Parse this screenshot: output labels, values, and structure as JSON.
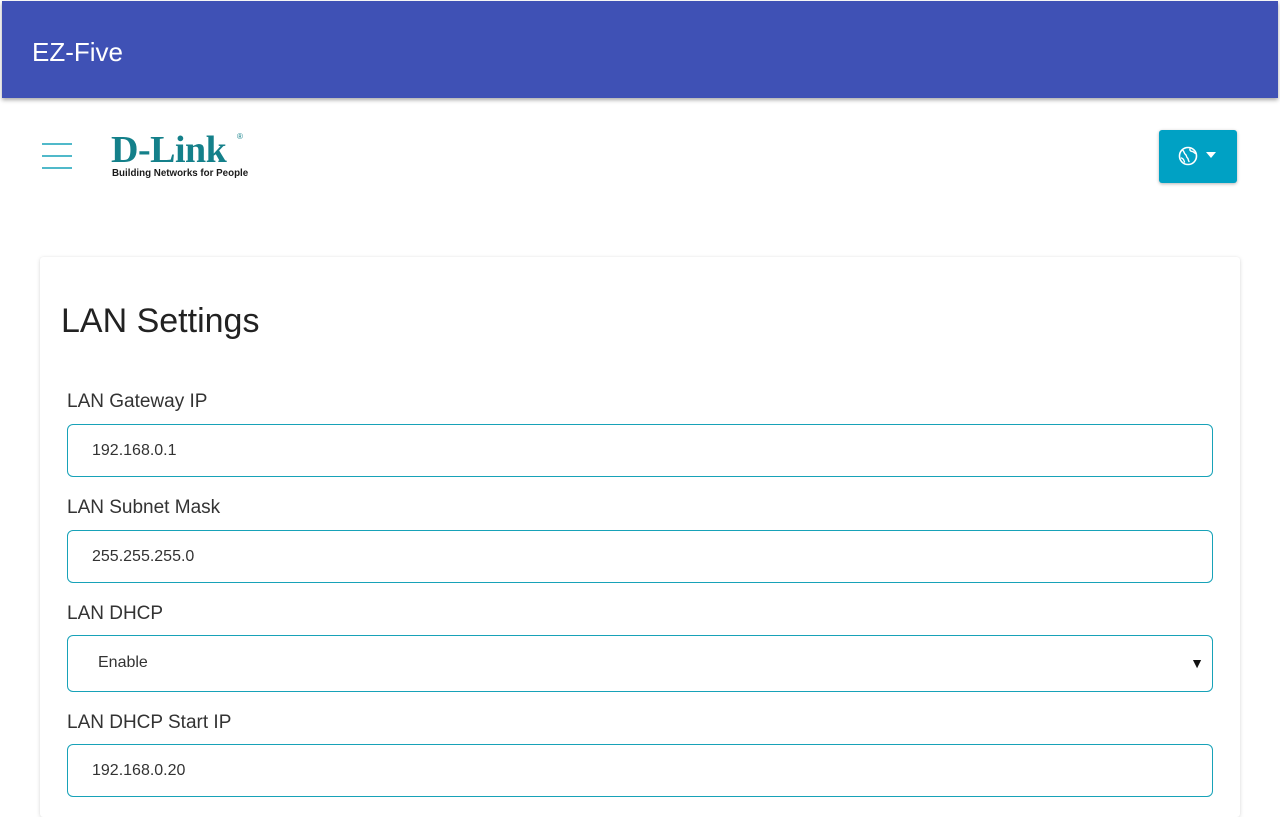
{
  "appbar": {
    "title": "EZ-Five",
    "color": "#3f51b5"
  },
  "header": {
    "menu_icon": "hamburger-menu-icon",
    "logo": {
      "brand": "D-Link",
      "registered_mark": "®",
      "tagline": "Building Networks for People",
      "color": "#14808a"
    },
    "language_button": {
      "icon": "globe-icon",
      "caret_icon": "caret-down-icon",
      "color": "#00a1c4"
    }
  },
  "lan_settings": {
    "title": "LAN Settings",
    "accent_color": "#17a2b8",
    "gateway_ip": {
      "label": "LAN Gateway IP",
      "value": "192.168.0.1"
    },
    "subnet_mask": {
      "label": "LAN Subnet Mask",
      "value": "255.255.255.0"
    },
    "dhcp": {
      "label": "LAN DHCP",
      "selected": "Enable"
    },
    "dhcp_start_ip": {
      "label": "LAN DHCP Start IP",
      "value": "192.168.0.20"
    }
  }
}
